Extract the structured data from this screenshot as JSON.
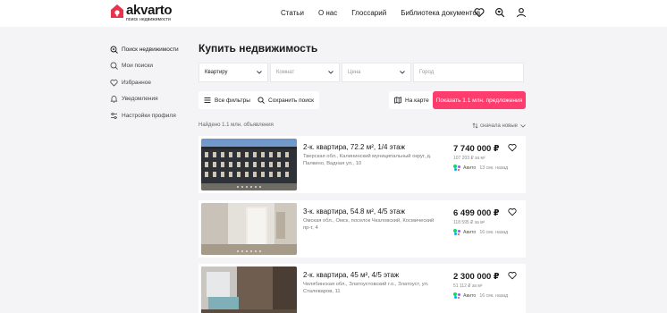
{
  "header": {
    "logo_name": "akvarto",
    "logo_tagline": "поиск недвижимости",
    "nav": [
      "Статьи",
      "О нас",
      "Глоссарий",
      "Библиотека документов"
    ]
  },
  "sidebar": {
    "items": [
      {
        "label": "Поиск недвижимости",
        "icon": "search-icon"
      },
      {
        "label": "Мои поиски",
        "icon": "saved-search-icon"
      },
      {
        "label": "Избранное",
        "icon": "heart-icon"
      },
      {
        "label": "Уведомления",
        "icon": "bell-icon"
      },
      {
        "label": "Настройки профиля",
        "icon": "sliders-icon"
      }
    ]
  },
  "main": {
    "title": "Купить недвижимость",
    "filters": {
      "type_value": "Квартиру",
      "rooms_placeholder": "Комнат",
      "price_placeholder": "Цена",
      "city_placeholder": "Город"
    },
    "buttons": {
      "all_filters": "Все фильтры",
      "save_search": "Сохранить поиск",
      "on_map": "На карте",
      "show_results": "Показать 1.1 млн. предложения"
    },
    "found_text": "Найдено 1.1 млн. объявления",
    "sort_label": "сначала новые"
  },
  "listings": [
    {
      "title": "2-к. квартира, 72.2 м², 1/4 этаж",
      "address": "Тверская обл., Калининский муниципальный округ, д. Палкино, Вадная ул., 10",
      "price": "7 740 000 ₽",
      "price_per_m2": "107 203 ₽ за м²",
      "source": "Авито",
      "ago": "13 сек. назад"
    },
    {
      "title": "3-к. квартира, 54.8 м², 4/5 этаж",
      "address": "Омская обл., Омск, поселок Чкаловский, Космический пр-т, 4",
      "price": "6 499 000 ₽",
      "price_per_m2": "118 595 ₽ за м²",
      "source": "Авито",
      "ago": "16 сек. назад"
    },
    {
      "title": "2-к. квартира, 45 м², 4/5 этаж",
      "address": "Челябинская обл., Златоустовский г.о., Златоуст, ул. Сталеваров, 11",
      "price": "2 300 000 ₽",
      "price_per_m2": "51 112 ₽ за м²",
      "source": "Авито",
      "ago": "16 сек. назад"
    }
  ],
  "colors": {
    "accent": "#ff3c6e",
    "logo": "#e8334a",
    "background": "#f4f4f6"
  }
}
